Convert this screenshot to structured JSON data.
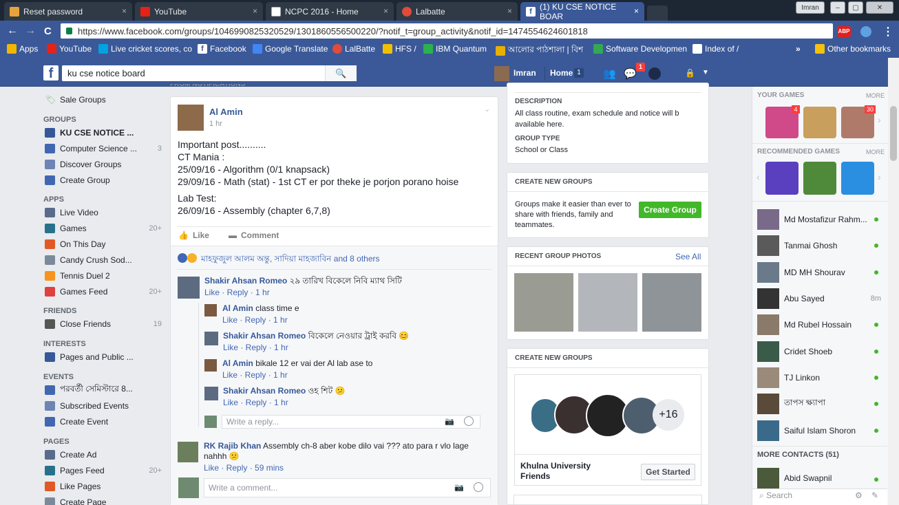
{
  "tabs": [
    {
      "title": "Reset password",
      "color": "#e9a33b"
    },
    {
      "title": "YouTube",
      "color": "#e62117"
    },
    {
      "title": "NCPC 2016 - Home",
      "color": "#ffffff"
    },
    {
      "title": "Lalbatte",
      "color": "#e24a3a"
    },
    {
      "title": "(1) KU CSE NOTICE BOAR",
      "color": "#3b5998"
    }
  ],
  "tab_close": "×",
  "window_user": "Imran",
  "url": "https://www.facebook.com/groups/1046990825320529/1301860556500220/?notif_t=group_activity&notif_id=1474554624601818",
  "nav": {
    "back": "←",
    "forward": "→",
    "reload": "C",
    "star": "☆",
    "menu": "⋮",
    "abp": "ABP"
  },
  "bookmarks": [
    "Apps",
    "YouTube",
    "Live cricket scores, co",
    "Facebook",
    "Google Translate",
    "LalBatte",
    "HFS /",
    "IBM Quantum",
    "আলোর পাঠশালা | বিশ",
    "Software Developmen",
    "Index of /"
  ],
  "bookmarks_more": "»",
  "other_bookmarks": "Other bookmarks",
  "fb": {
    "logo": "f",
    "search_value": "ku cse notice board",
    "search_icon": "🔍",
    "user": "Imran",
    "home": "Home",
    "home_count": "1",
    "notif_count": "1",
    "lock_icon": "🔒",
    "caret": "▼"
  },
  "left": {
    "truncated_header": "FROM NOTIFICATIONS",
    "sale_groups": "Sale Groups",
    "groups_h": "GROUPS",
    "group_items": [
      {
        "label": "KU CSE NOTICE ...",
        "count": ""
      },
      {
        "label": "Computer Science ...",
        "count": "3"
      },
      {
        "label": "Discover Groups",
        "count": ""
      },
      {
        "label": "Create Group",
        "count": ""
      }
    ],
    "apps_h": "APPS",
    "app_items": [
      {
        "label": "Live Video",
        "count": ""
      },
      {
        "label": "Games",
        "count": "20+"
      },
      {
        "label": "On This Day",
        "count": ""
      },
      {
        "label": "Candy Crush Sod...",
        "count": ""
      },
      {
        "label": "Tennis Duel 2",
        "count": ""
      },
      {
        "label": "Games Feed",
        "count": "20+"
      }
    ],
    "friends_h": "FRIENDS",
    "friend_items": [
      {
        "label": "Close Friends",
        "count": "19"
      }
    ],
    "interests_h": "INTERESTS",
    "interest_items": [
      {
        "label": "Pages and Public ...",
        "count": ""
      }
    ],
    "events_h": "EVENTS",
    "event_items": [
      {
        "label": "পরবর্তী সেমিস্টারে 8...",
        "count": ""
      },
      {
        "label": "Subscribed Events",
        "count": ""
      },
      {
        "label": "Create Event",
        "count": ""
      }
    ],
    "pages_h": "PAGES",
    "page_items": [
      {
        "label": "Create Ad",
        "count": ""
      },
      {
        "label": "Pages Feed",
        "count": "20+"
      },
      {
        "label": "Like Pages",
        "count": ""
      },
      {
        "label": "Create Page",
        "count": ""
      }
    ]
  },
  "post": {
    "author": "Al Amin",
    "time": "1 hr",
    "lines": [
      "Important post..........",
      "CT Mania :",
      "25/09/16 - Algorithm (0/1 knapsack)",
      "29/09/16 - Math (stat) - 1st CT er por theke je porjon porano hoise",
      "Lab Test:",
      "26/09/16 - Assembly (chapter 6,7,8)"
    ],
    "like": "Like",
    "comment": "Comment",
    "reactions": "মাহফুজুল আলম অন্তু, সাদিয়া মাহজাবিন and 8 others",
    "comments": [
      {
        "name": "Shakir Ahsan Romeo",
        "text": "২৯ তারিখ বিকেলে নিবি ম্যাথ সিটি",
        "meta": "Like · Reply · 1 hr"
      },
      {
        "name": "Al Amin",
        "text": "class time e",
        "meta": "Like · Reply · 1 hr"
      },
      {
        "name": "Shakir Ahsan Romeo",
        "text": "বিকেলে নেওয়ার ট্রাই করবি 😊",
        "meta": "Like · Reply · 1 hr"
      },
      {
        "name": "Al Amin",
        "text": "bikale 12 er vai der Al lab ase to",
        "meta": "Like · Reply · 1 hr"
      },
      {
        "name": "Shakir Ahsan Romeo",
        "text": "ওহ শিট 😕",
        "meta": "Like · Reply · 1 hr"
      },
      {
        "name": "RK Rajib Khan",
        "text": "Assembly ch-8 aber kobe dilo vai ??? ato para r vlo lage nahhh 😕",
        "meta": "Like · Reply · 59 mins"
      }
    ],
    "reply_placeholder": "Write a reply...",
    "comment_placeholder": "Write a comment..."
  },
  "mid": {
    "description_h": "DESCRIPTION",
    "description": "All class routine, exam schedule and notice will b available here.",
    "type_h": "GROUP TYPE",
    "type": "School or Class",
    "create_h": "CREATE NEW GROUPS",
    "create_text": "Groups make it easier than ever to share with friends, family and teammates.",
    "create_btn": "Create Group",
    "photos_h": "RECENT GROUP PHOTOS",
    "see_all": "See All",
    "create2_h": "CREATE NEW GROUPS",
    "plus": "+16",
    "suggest_name": "Khulna University Friends",
    "get_started": "Get Started"
  },
  "right": {
    "games_h": "YOUR GAMES",
    "more": "MORE",
    "game_badges": [
      "4",
      "",
      "30"
    ],
    "rec_h": "RECOMMENDED GAMES",
    "contacts": [
      {
        "name": "Md Mostafizur Rahm...",
        "status": "online"
      },
      {
        "name": "Tanmai Ghosh",
        "status": "online"
      },
      {
        "name": "MD MH Shourav",
        "status": "online"
      },
      {
        "name": "Abu Sayed",
        "status": "8m"
      },
      {
        "name": "Md Rubel Hossain",
        "status": "online"
      },
      {
        "name": "Cridet Shoeb",
        "status": "online"
      },
      {
        "name": "TJ Linkon",
        "status": "online"
      },
      {
        "name": "তাপস ক্ষ্যাপা",
        "status": "online"
      },
      {
        "name": "Saiful Islam Shoron",
        "status": "online"
      }
    ],
    "more_contacts": "MORE CONTACTS (51)",
    "extra_contact": "Abid Swapnil",
    "search": "Search"
  }
}
